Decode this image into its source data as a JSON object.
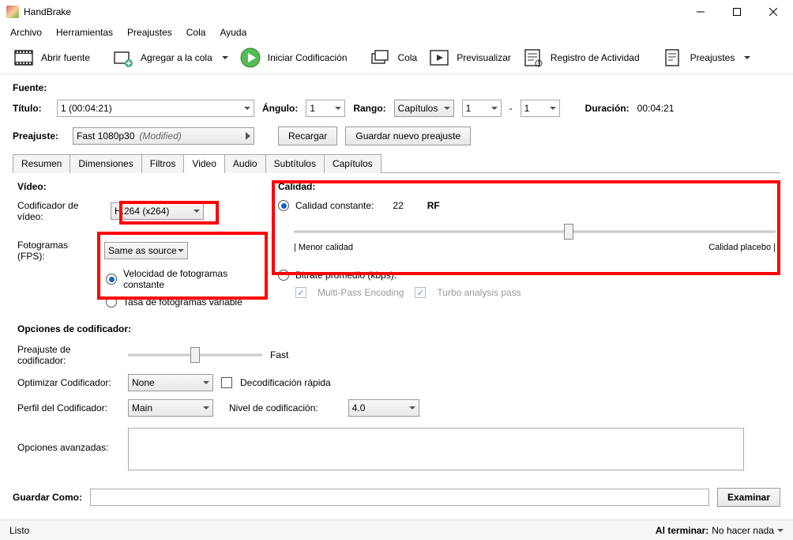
{
  "window": {
    "title": "HandBrake"
  },
  "menu": {
    "items": [
      "Archivo",
      "Herramientas",
      "Preajustes",
      "Cola",
      "Ayuda"
    ]
  },
  "toolbar": {
    "open": "Abrir fuente",
    "addQueue": "Agregar a la cola",
    "start": "Iniciar Codificación",
    "queue": "Cola",
    "preview": "Previsualizar",
    "activity": "Registro de Actividad",
    "presets": "Preajustes"
  },
  "source": {
    "label": "Fuente:"
  },
  "titleRow": {
    "titleLabel": "Título:",
    "titleValue": "1 (00:04:21)",
    "angleLabel": "Ángulo:",
    "angleValue": "1",
    "rangeLabel": "Rango:",
    "rangeType": "Capítulos",
    "rangeFrom": "1",
    "rangeSep": "-",
    "rangeTo": "1",
    "durationLabel": "Duración:",
    "durationValue": "00:04:21"
  },
  "presetRow": {
    "label": "Preajuste:",
    "valuePrefix": "Fast 1080p30",
    "valueSuffix": "(Modified)",
    "reload": "Recargar",
    "savePreset": "Guardar nuevo preajuste"
  },
  "tabs": [
    "Resumen",
    "Dimensiones",
    "Filtros",
    "Video",
    "Audio",
    "Subtítulos",
    "Capítulos"
  ],
  "video": {
    "heading": "Vídeo:",
    "codecLabel": "Codificador de vídeo:",
    "codecValue": "H.264 (x264)",
    "fpsLabel": "Fotogramas (FPS):",
    "fpsValue": "Same as source",
    "cfr": "Velocidad de fotogramas constante",
    "vfr": "Tasa de fotogramas variable"
  },
  "quality": {
    "heading": "Calidad:",
    "cqLabel": "Calidad constante:",
    "cqValue": "22",
    "cqSuffix": "RF",
    "low": "| Menor calidad",
    "high": "Calidad placebo |",
    "abrLabel": "Bitrate promedio (kbps):",
    "multipass": "Multi-Pass Encoding",
    "turbo": "Turbo analysis pass"
  },
  "encoder": {
    "heading": "Opciones de codificador:",
    "presetLabel": "Preajuste de codificador:",
    "presetValue": "Fast",
    "tuneLabel": "Optimizar Codificador:",
    "tuneValue": "None",
    "fastDecode": "Decodificación rápida",
    "profileLabel": "Perfil del Codificador:",
    "profileValue": "Main",
    "levelLabel": "Nivel de codificación:",
    "levelValue": "4.0",
    "advLabel": "Opciones avanzadas:"
  },
  "save": {
    "label": "Guardar Como:",
    "browse": "Examinar"
  },
  "status": {
    "ready": "Listo",
    "whenDoneLabel": "Al terminar:",
    "whenDoneValue": "No hacer nada"
  }
}
